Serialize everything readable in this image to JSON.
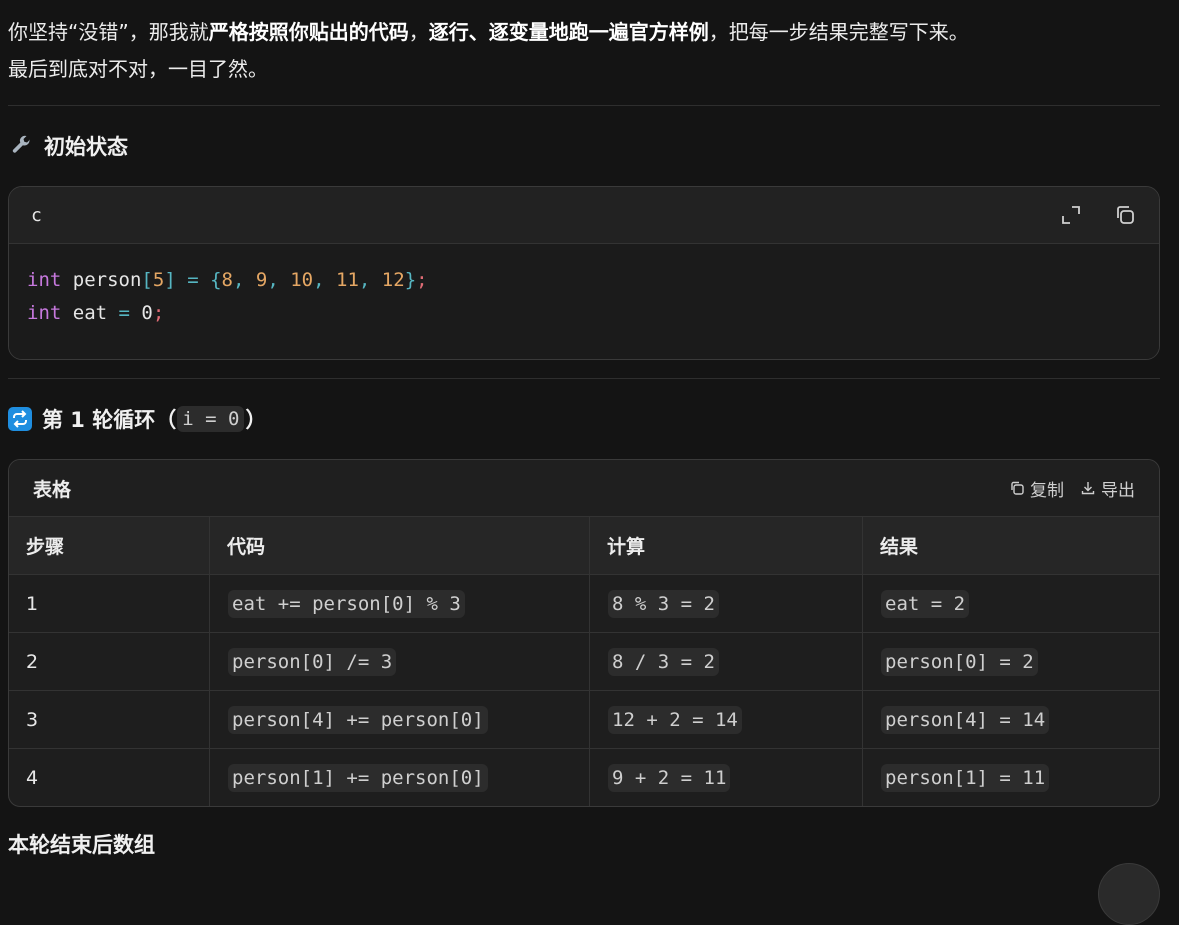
{
  "intro": {
    "p1": "你坚持“没错”，那我就",
    "b1": "严格按照你贴出的代码",
    "p2": "，",
    "b2": "逐行、逐变量地跑一遍官方样例",
    "p3": "，把每一步结果完整写下来。",
    "line2": "最后到底对不对，一目了然。"
  },
  "section1": {
    "title": "初始状态",
    "icon": "wrench-icon"
  },
  "code": {
    "lang": "c",
    "tools": [
      "expand-icon",
      "copy-icon"
    ],
    "line1": {
      "kw": "int",
      "name": " person",
      "lb": "[",
      "n": "5",
      "rb": "]",
      "eq": " = ",
      "lc": "{",
      "v1": "8",
      "v2": "9",
      "v3": "10",
      "v4": "11",
      "v5": "12",
      "comma": ", ",
      "rc": "}",
      "semi": ";"
    },
    "line2": {
      "kw": "int",
      "name": " eat",
      "eq": " = ",
      "v": "0",
      "semi": ";"
    }
  },
  "section2": {
    "prefix": "第 1 轮循环（",
    "code": "i = 0",
    "suffix": "）",
    "icon": "loop-icon"
  },
  "table": {
    "title": "表格",
    "copy_label": "复制",
    "export_label": "导出",
    "headers": [
      "步骤",
      "代码",
      "计算",
      "结果"
    ],
    "rows": [
      [
        "1",
        "eat += person[0] % 3",
        "8 % 3 = 2",
        "eat = 2"
      ],
      [
        "2",
        "person[0] /= 3",
        "8 / 3 = 2",
        "person[0] = 2"
      ],
      [
        "3",
        "person[4] += person[0]",
        "12 + 2 = 14",
        "person[4] = 14"
      ],
      [
        "4",
        "person[1] += person[0]",
        "9 + 2 = 11",
        "person[1] = 11"
      ]
    ]
  },
  "section3": {
    "title": "本轮结束后数组"
  }
}
